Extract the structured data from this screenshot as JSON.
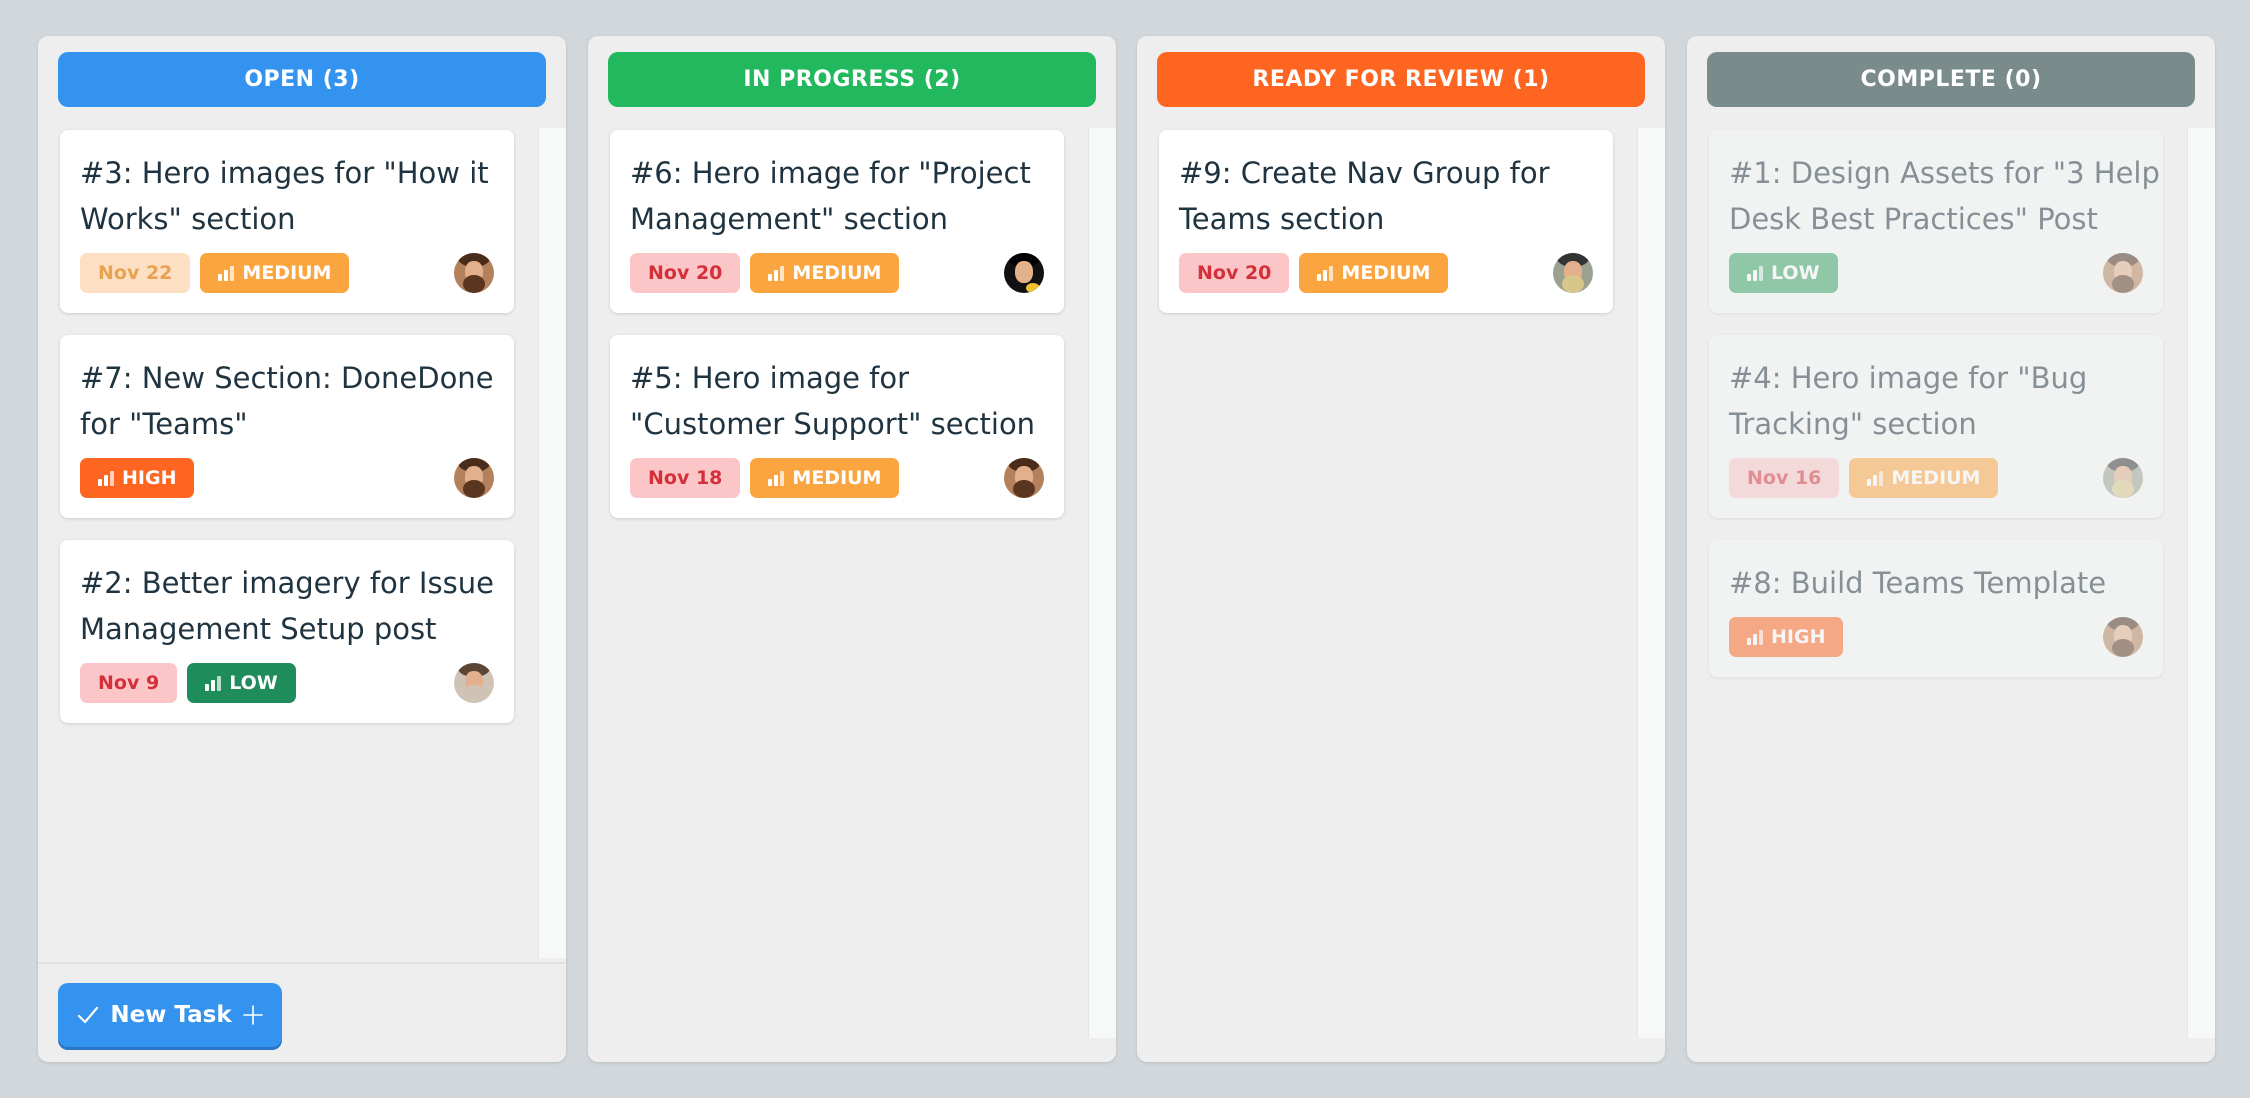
{
  "colors": {
    "open": "#3593f0",
    "in_progress": "#22b85d",
    "review": "#fe6520",
    "complete": "#7a8b8c",
    "medium": "#fba540",
    "high": "#fe6520",
    "low": "#1f8c5c"
  },
  "columns": [
    {
      "header": "OPEN (3)",
      "cards": [
        {
          "title_line1": "#3: Hero images for \"How it",
          "title_line2": "Works\" section",
          "date": "Nov 22",
          "priority": "MEDIUM",
          "priority_icon": "signal-bars-icon",
          "avatar": "avatar-bearded-man"
        },
        {
          "title_line1": "#7: New Section: DoneDone",
          "title_line2": "for \"Teams\"",
          "priority": "HIGH",
          "priority_icon": "signal-bars-icon",
          "avatar": "avatar-bearded-man"
        },
        {
          "title_line1": "#2: Better imagery for Issue",
          "title_line2": "Management Setup post",
          "date": "Nov 9",
          "priority": "LOW",
          "priority_icon": "signal-bars-icon",
          "avatar": "avatar-light-haired-man"
        }
      ],
      "new_task_label": "New Task",
      "new_task_icons": [
        "checkmark-icon",
        "plus-icon"
      ]
    },
    {
      "header": "IN PROGRESS (2)",
      "cards": [
        {
          "title_line1": "#6: Hero image for \"Project",
          "title_line2": "Management\" section",
          "date": "Nov 20",
          "priority": "MEDIUM",
          "priority_icon": "signal-bars-icon",
          "avatar": "avatar-dark-haired-person"
        },
        {
          "title_line1": "#5: Hero image for",
          "title_line2": "\"Customer Support\" section",
          "date": "Nov 18",
          "priority": "MEDIUM",
          "priority_icon": "signal-bars-icon",
          "avatar": "avatar-bearded-man"
        }
      ]
    },
    {
      "header": "READY FOR REVIEW (1)",
      "cards": [
        {
          "title_line1": "#9: Create Nav Group for",
          "title_line2": "Teams section",
          "date": "Nov 20",
          "priority": "MEDIUM",
          "priority_icon": "signal-bars-icon",
          "avatar": "avatar-man-glasses"
        }
      ]
    },
    {
      "header": "COMPLETE (0)",
      "cards": [
        {
          "title_line1": "#1: Design Assets for \"3 Help",
          "title_line2": "Desk Best Practices\" Post",
          "priority": "LOW",
          "priority_icon": "signal-bars-icon",
          "avatar": "avatar-bearded-man"
        },
        {
          "title_line1": "#4: Hero image for \"Bug",
          "title_line2": "Tracking\" section",
          "date": "Nov 16",
          "priority": "MEDIUM",
          "priority_icon": "signal-bars-icon",
          "avatar": "avatar-man-hat"
        },
        {
          "title_line1": "#8: Build Teams Template",
          "priority": "HIGH",
          "priority_icon": "signal-bars-icon",
          "avatar": "avatar-bearded-man"
        }
      ]
    }
  ]
}
